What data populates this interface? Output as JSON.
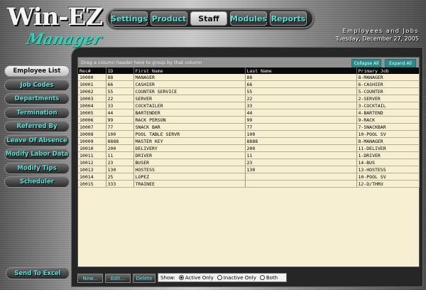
{
  "logo": {
    "main": "Win-EZ",
    "sub": "Manager"
  },
  "nav": [
    {
      "label": "Settings"
    },
    {
      "label": "Product"
    },
    {
      "label": "Staff"
    },
    {
      "label": "Modules"
    },
    {
      "label": "Reports"
    }
  ],
  "nav_active": "Staff",
  "header": {
    "section": "Employees and Jobs",
    "date": "Tuesday, December 27, 2005"
  },
  "sidebar": {
    "items": [
      {
        "label": "Employee List"
      },
      {
        "label": "Job Codes"
      },
      {
        "label": "Departments"
      },
      {
        "label": "Termination"
      },
      {
        "label": "Referred By"
      },
      {
        "label": "Leave Of Absence"
      },
      {
        "label": "Modify Labor Data"
      },
      {
        "label": "Modify Tips"
      },
      {
        "label": "Scheduler"
      }
    ],
    "active": "Employee List",
    "send_to_excel": "Send To Excel"
  },
  "grid": {
    "group_hint": "Drag a column header here to group by that column",
    "collapse_all": "Collapse All",
    "expand_all": "Expand All",
    "columns": [
      "Rec#",
      "ID",
      "First Name",
      "Last Name",
      "Primary Job"
    ],
    "rows": [
      [
        "10000",
        "88",
        "MANAGER",
        "88",
        "8-MANAGER"
      ],
      [
        "10001",
        "66",
        "CASHIER",
        "66",
        "6-CASHIER"
      ],
      [
        "10002",
        "55",
        "COUNTER SERVICE",
        "55",
        "5-COUNTER"
      ],
      [
        "10003",
        "22",
        "SERVER",
        "22",
        "2-SERVER"
      ],
      [
        "10004",
        "33",
        "COCKTAILER",
        "33",
        "3-COCKTAIL"
      ],
      [
        "10005",
        "44",
        "BARTENDER",
        "44",
        "4-BARTEND"
      ],
      [
        "10006",
        "99",
        "RACK PERSON",
        "99",
        "9-RACK"
      ],
      [
        "10007",
        "77",
        "SNACK BAR",
        "77",
        "7-SNACKBAR"
      ],
      [
        "10008",
        "100",
        "POOL TABLE SERVR",
        "100",
        "10-POOL SV"
      ],
      [
        "10009",
        "8888",
        "MASTER KEY",
        "8888",
        "8-MANAGER"
      ],
      [
        "10010",
        "200",
        "DELIVERY",
        "200",
        "11-DELIVER"
      ],
      [
        "10011",
        "11",
        "DRIVER",
        "11",
        "1-DRIVER"
      ],
      [
        "10012",
        "23",
        "BUSER",
        "23",
        "14-BUS"
      ],
      [
        "10013",
        "130",
        "HOSTESS",
        "130",
        "13-HOSTESS"
      ],
      [
        "10014",
        "25",
        "LOPEZ",
        "",
        "10-POOL SV"
      ],
      [
        "10015",
        "333",
        "TRAINEE",
        "",
        "12-D/THRU"
      ]
    ]
  },
  "actions": {
    "new": "New...",
    "edit": "Edit...",
    "delete": "Delete"
  },
  "show": {
    "label": "Show:",
    "options": [
      "Active Only",
      "Inactive Only",
      "Both"
    ],
    "selected": "Active Only"
  },
  "colors": {
    "accent": "#58e0d8",
    "grid_bg": "#f6efd2",
    "header_bg": "#0a0a0a"
  }
}
